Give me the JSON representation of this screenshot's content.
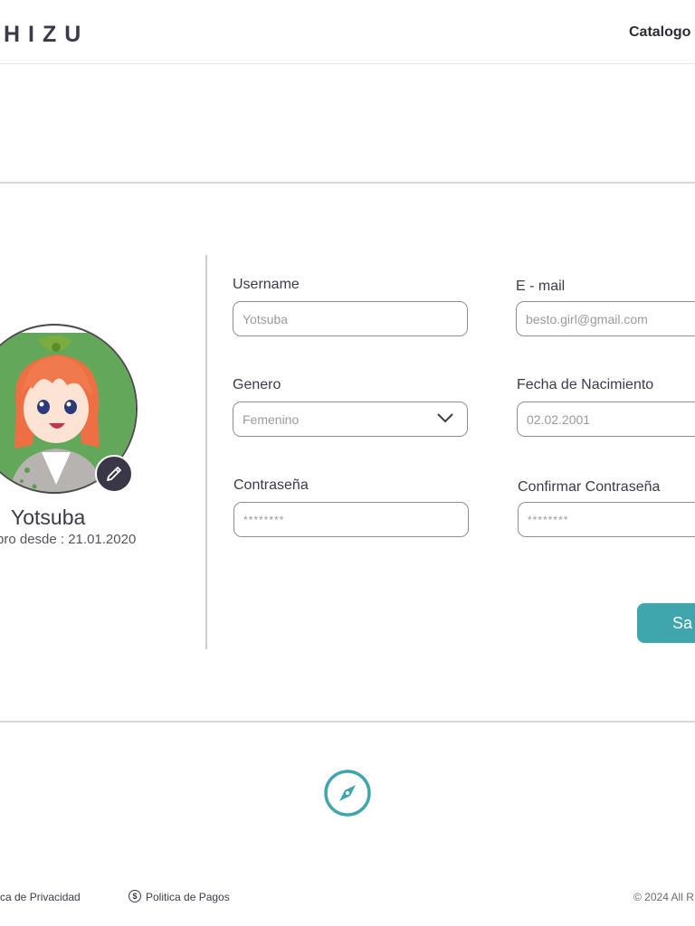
{
  "header": {
    "logo": "HIZU",
    "nav_catalogo": "Catalogo"
  },
  "profile": {
    "name": "Yotsuba",
    "member_since": "bro desde : 21.01.2020"
  },
  "form": {
    "username": {
      "label": "Username",
      "value": "Yotsuba"
    },
    "email": {
      "label": "E - mail",
      "value": "besto.girl@gmail.com"
    },
    "genero": {
      "label": "Genero",
      "value": "Femenino"
    },
    "fecha": {
      "label": "Fecha de Nacimiento",
      "value": "02.02.2001"
    },
    "password": {
      "label": "Contraseña",
      "value": "********"
    },
    "confirm_password": {
      "label": "Confirmar Contraseña",
      "value": "********"
    },
    "save_label": "Sa"
  },
  "footer": {
    "privacy": "ca de Privacidad",
    "payments": "Politica de Pagos",
    "payments_icon": "$",
    "copyright": "© 2024 All R"
  },
  "colors": {
    "accent": "#3fa6ae",
    "dark": "#3a3848"
  }
}
